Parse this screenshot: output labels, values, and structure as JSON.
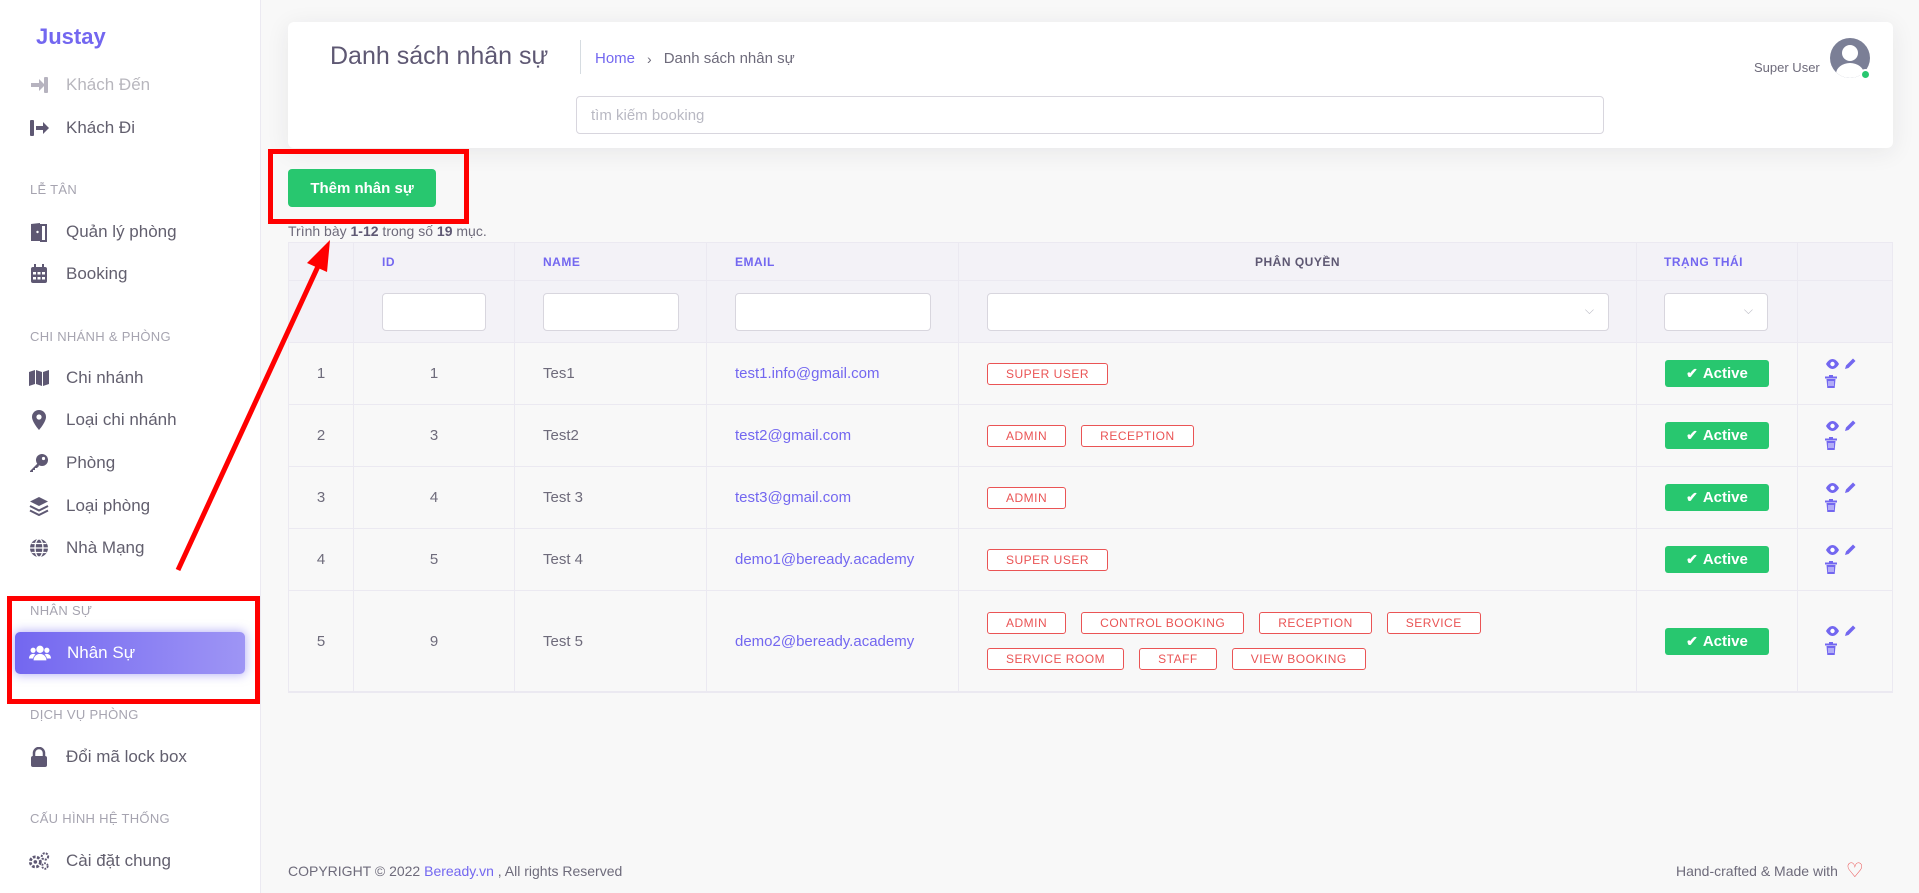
{
  "app": {
    "brand": "Justay"
  },
  "sidebar": {
    "items_top": [
      {
        "label": "Khách Đến",
        "icon": "sign-in-icon"
      },
      {
        "label": "Khách Đi",
        "icon": "sign-out-icon"
      }
    ],
    "sections": {
      "le_tan": "LỄ TÂN",
      "chi_nhanh": "CHI NHÁNH & PHÒNG",
      "nhan_su": "NHÂN SỰ",
      "dich_vu": "DỊCH VỤ PHÒNG",
      "cau_hinh": "CẤU HÌNH HỆ THỐNG"
    },
    "le_tan_items": [
      {
        "label": "Quản lý phòng",
        "icon": "door-icon"
      },
      {
        "label": "Booking",
        "icon": "calendar-icon"
      }
    ],
    "chi_nhanh_items": [
      {
        "label": "Chi nhánh",
        "icon": "map-icon"
      },
      {
        "label": "Loại chi nhánh",
        "icon": "map-marker-icon"
      },
      {
        "label": "Phòng",
        "icon": "key-icon"
      },
      {
        "label": "Loại phòng",
        "icon": "layers-icon"
      },
      {
        "label": "Nhà Mạng",
        "icon": "globe-icon"
      }
    ],
    "nhan_su_item": {
      "label": "Nhân Sự",
      "icon": "users-icon"
    },
    "dich_vu_item": {
      "label": "Đổi mã lock box",
      "icon": "lock-icon"
    },
    "cau_hinh_item": {
      "label": "Cài đặt chung",
      "icon": "cogs-icon"
    }
  },
  "header": {
    "title": "Danh sách nhân sự",
    "breadcrumb_home": "Home",
    "breadcrumb_current": "Danh sách nhân sự",
    "search_placeholder": "tìm kiếm booking",
    "user_name": "Super User"
  },
  "toolbar": {
    "add_label": "Thêm nhân sự",
    "summary_prefix": "Trình bày ",
    "summary_range": "1-12",
    "summary_mid": " trong số ",
    "summary_total": "19",
    "summary_suffix": " mục."
  },
  "table": {
    "headers": [
      "",
      "ID",
      "NAME",
      "EMAIL",
      "PHÂN QUYỀN",
      "TRẠNG THÁI",
      ""
    ],
    "rows": [
      {
        "no": "1",
        "id": "1",
        "name": "Tes1",
        "email": "test1.info@gmail.com",
        "roles": [
          "SUPER USER"
        ],
        "status": "Active"
      },
      {
        "no": "2",
        "id": "3",
        "name": "Test2",
        "email": "test2@gmail.com",
        "roles": [
          "ADMIN",
          "RECEPTION"
        ],
        "status": "Active"
      },
      {
        "no": "3",
        "id": "4",
        "name": "Test 3",
        "email": "test3@gmail.com",
        "roles": [
          "ADMIN"
        ],
        "status": "Active"
      },
      {
        "no": "4",
        "id": "5",
        "name": "Test 4",
        "email": "demo1@beready.academy",
        "roles": [
          "SUPER USER"
        ],
        "status": "Active"
      },
      {
        "no": "5",
        "id": "9",
        "name": "Test 5",
        "email": "demo2@beready.academy",
        "roles": [
          "ADMIN",
          "CONTROL BOOKING",
          "RECEPTION",
          "SERVICE",
          "SERVICE ROOM",
          "STAFF",
          "VIEW BOOKING"
        ],
        "status": "Active"
      }
    ]
  },
  "footer": {
    "copyright": "COPYRIGHT © 2022 ",
    "brand_link": "Beready.vn",
    "rights": " , All rights Reserved",
    "made_with": "Hand-crafted & Made with"
  },
  "colors": {
    "primary": "#7367f0",
    "success": "#28c76f",
    "danger": "#ea5455",
    "annotation": "#ff0000"
  }
}
